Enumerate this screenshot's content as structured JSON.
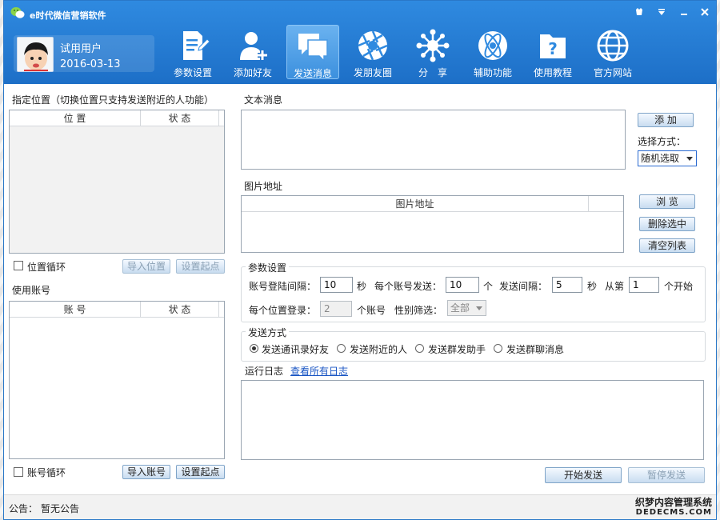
{
  "app": {
    "title": "e时代微信营销软件"
  },
  "user": {
    "name": "试用用户",
    "date": "2016-03-13"
  },
  "nav": [
    {
      "label": "参数设置",
      "icon": "doc-pen-icon"
    },
    {
      "label": "添加好友",
      "icon": "add-user-icon"
    },
    {
      "label": "发送消息",
      "icon": "chat-icon"
    },
    {
      "label": "发朋友圈",
      "icon": "aperture-icon"
    },
    {
      "label": "分　享",
      "icon": "share-network-icon"
    },
    {
      "label": "辅助功能",
      "icon": "atom-icon"
    },
    {
      "label": "使用教程",
      "icon": "help-folder-icon"
    },
    {
      "label": "官方网站",
      "icon": "globe-icon"
    }
  ],
  "location": {
    "title": "指定位置（切换位置只支持发送附近的人功能）",
    "col_pos": "位 置",
    "col_status": "状 态",
    "loop_label": "位置循环",
    "import_btn": "导入位置",
    "set_start_btn": "设置起点"
  },
  "accounts": {
    "title": "使用账号",
    "col_acc": "账 号",
    "col_status": "状 态",
    "loop_label": "账号循环",
    "import_btn": "导入账号",
    "set_start_btn": "设置起点"
  },
  "text_msg": {
    "title": "文本消息",
    "add_btn": "添 加",
    "mode_label": "选择方式：",
    "mode_value": "随机选取"
  },
  "image": {
    "title": "图片地址",
    "col": "图片地址",
    "browse_btn": "浏 览",
    "delete_btn": "删除选中",
    "clear_btn": "清空列表"
  },
  "params": {
    "title": "参数设置",
    "login_interval_label": "账号登陆间隔：",
    "login_interval_value": "10",
    "sec1": "秒",
    "per_account_label": "每个账号发送：",
    "per_account_value": "10",
    "unit_ge": "个",
    "send_interval_label": "发送间隔：",
    "send_interval_value": "5",
    "sec2": "秒",
    "from_label": "从第",
    "from_value": "1",
    "start_label": "个开始",
    "per_location_label": "每个位置登录：",
    "per_location_value": "2",
    "accounts_unit": "个账号",
    "gender_label": "性别筛选：",
    "gender_value": "全部"
  },
  "send_mode": {
    "title": "发送方式",
    "options": [
      "发送通讯录好友",
      "发送附近的人",
      "发送群发助手",
      "发送群聊消息"
    ]
  },
  "log": {
    "title": "运行日志",
    "view_all": "查看所有日志"
  },
  "actions": {
    "start_btn": "开始发送",
    "pause_btn": "暂停发送"
  },
  "status": {
    "label": "公告：",
    "value": "暂无公告"
  },
  "watermark": {
    "line1": "织梦内容管理系统",
    "line2": "DEDECMS.COM"
  },
  "colors": {
    "titlebar": "#1d6fc7",
    "accent": "#2f8ae0"
  }
}
